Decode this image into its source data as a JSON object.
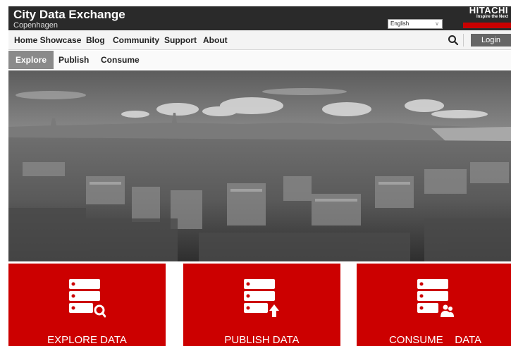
{
  "header": {
    "title": "City Data Exchange",
    "subtitle": "Copenhagen",
    "language": "English",
    "brand_logo": "HITACHI",
    "brand_tagline": "Inspire the Next",
    "brand_color": "#c80000"
  },
  "main_nav": {
    "items": [
      {
        "label": "Home Showcase"
      },
      {
        "label": "Blog"
      },
      {
        "label": "Community"
      },
      {
        "label": "Support"
      },
      {
        "label": "About"
      }
    ],
    "search_icon": "search-icon",
    "login_label": "Login"
  },
  "sub_nav": {
    "items": [
      {
        "label": "Explore",
        "active": true
      },
      {
        "label": "Publish",
        "active": false
      },
      {
        "label": "Consume",
        "active": false
      }
    ]
  },
  "hero": {
    "image": "grayscale panoramic city skyline photo"
  },
  "tiles": [
    {
      "label": "EXPLORE DATA",
      "icon": "database-search-icon"
    },
    {
      "label": "PUBLISH DATA",
      "icon": "database-upload-icon"
    },
    {
      "label": "CONSUME    DATA",
      "icon": "database-users-icon"
    }
  ],
  "colors": {
    "tile_red": "#cc0000",
    "topbar": "#2a2a2a",
    "active_tab": "#8a8a8a",
    "login_button": "#666666"
  }
}
